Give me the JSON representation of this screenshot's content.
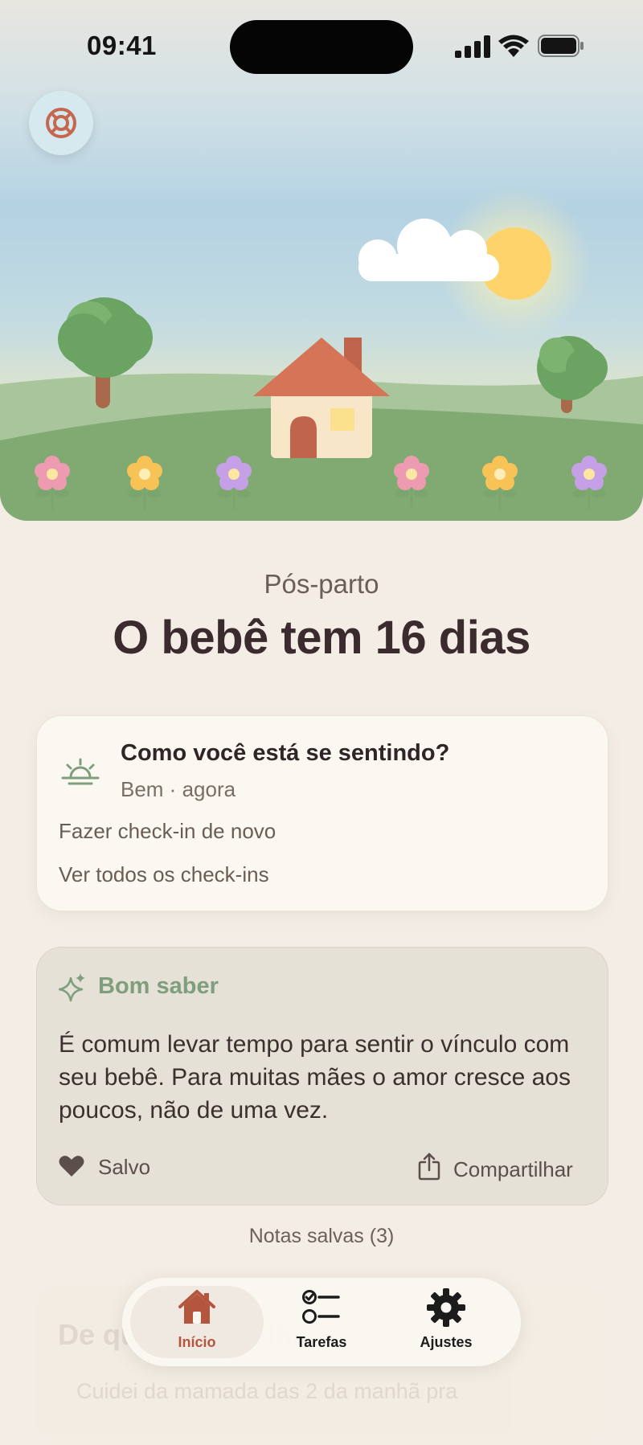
{
  "status_bar": {
    "time": "09:41"
  },
  "header": {
    "phase": "Pós-parto",
    "title": "O bebê tem 16 dias"
  },
  "checkin_card": {
    "question": "Como você está se sentindo?",
    "status": "Bem · agora",
    "link_again": "Fazer check-in de novo",
    "link_all": "Ver todos os check-ins"
  },
  "tip_card": {
    "heading": "Bom saber",
    "body": "É comum levar tempo para sentir o vínculo com seu bebê. Para muitas mães o amor cresce aos poucos, não de uma vez.",
    "saved_label": "Salvo",
    "share_label": "Compartilhar"
  },
  "saved_notes": "Notas salvas (3)",
  "journal_card": {
    "title": "De que se orgulha",
    "body": "Cuidei da mamada das 2 da manhã pra"
  },
  "tabbar": {
    "tabs": [
      {
        "label": "Início",
        "icon": "house-icon",
        "active": true
      },
      {
        "label": "Tarefas",
        "icon": "checklist-icon",
        "active": false
      },
      {
        "label": "Ajustes",
        "icon": "gear-icon",
        "active": false
      }
    ]
  },
  "colors": {
    "accent": "#b4553e",
    "sage": "#7f9e7d",
    "background": "#f3ede6"
  }
}
